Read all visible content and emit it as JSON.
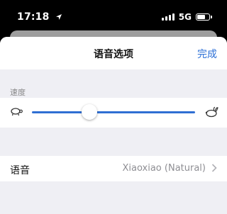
{
  "status_bar": {
    "time": "17:18",
    "network": "5G",
    "battery_level": 0.8,
    "signal_bars": 4
  },
  "sheet": {
    "title": "语音选项",
    "done_label": "完成",
    "speed_section_label": "速度",
    "speed_slider_value": 0.35,
    "slow_icon": "turtle-icon",
    "fast_icon": "rabbit-icon",
    "voice_label": "语音",
    "voice_value": "Xiaoxiao (Natural)"
  },
  "colors": {
    "accent": "#2b6fd6",
    "background": "#efeff4"
  }
}
